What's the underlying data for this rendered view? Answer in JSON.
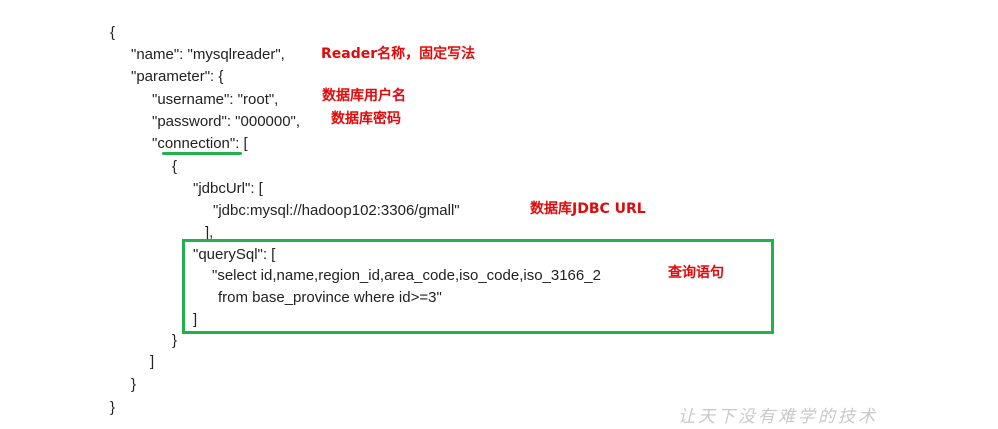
{
  "code": {
    "l1": "{",
    "l2": "\"name\": \"mysqlreader\",",
    "l3": "\"parameter\": {",
    "l4": "\"username\": \"root\",",
    "l5": "\"password\": \"000000\",",
    "l6": "\"connection\": [",
    "l7": "{",
    "l8": "\"jdbcUrl\": [",
    "l9": "\"jdbc:mysql://hadoop102:3306/gmall\"",
    "l10": "],",
    "l11": "\"querySql\": [",
    "l12": "\"select id,name,region_id,area_code,iso_code,iso_3166_2",
    "l13": "from base_province where id>=3\"",
    "l14": "]",
    "l15": "}",
    "l16": "]",
    "l17": "}",
    "l18": "}"
  },
  "annotations": {
    "reader_name": "Reader名称，固定写法",
    "db_user": "数据库用户名",
    "db_password": "数据库密码",
    "db_jdbc_url": "数据库JDBC URL",
    "query_sql": "查询语句"
  },
  "watermark": "让天下没有难学的技术",
  "colors": {
    "annotation": "#e10a0a",
    "highlight": "#22b14c",
    "code_text": "#222222"
  }
}
